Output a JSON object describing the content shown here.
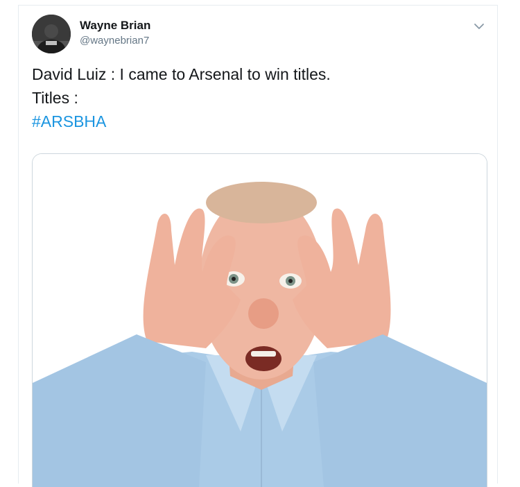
{
  "author": {
    "name": "Wayne Brian",
    "handle": "@waynebrian7"
  },
  "tweet": {
    "line1": "David Luiz : I came to Arsenal to win titles.",
    "line2": "Titles :",
    "hashtag": "#ARSBHA"
  },
  "icons": {
    "menu": "chevron-down-icon"
  },
  "colors": {
    "link": "#1b95e0",
    "text": "#14171a",
    "muted": "#657786"
  }
}
